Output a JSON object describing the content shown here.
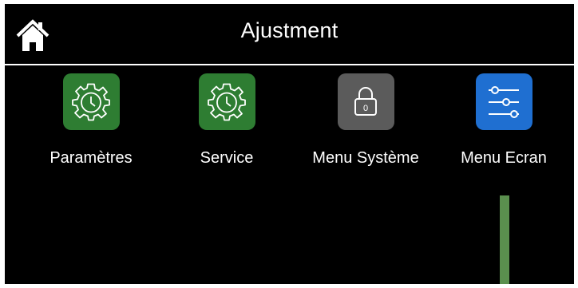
{
  "header": {
    "title": "Ajustment",
    "home_icon": "home-icon"
  },
  "tiles": [
    {
      "label": "Paramètres",
      "icon": "gear-clock-icon",
      "color": "#2e7d32"
    },
    {
      "label": "Service",
      "icon": "gear-clock-icon",
      "color": "#2e7d32"
    },
    {
      "label": "Menu Système",
      "icon": "lock-icon",
      "color": "#5b5b5b",
      "lock_code": "0"
    },
    {
      "label": "Menu Ecran",
      "icon": "sliders-icon",
      "color": "#1f6fd1"
    }
  ],
  "colors": {
    "background": "#000000",
    "text": "#ffffff",
    "accent_green": "#5a8f4e"
  }
}
